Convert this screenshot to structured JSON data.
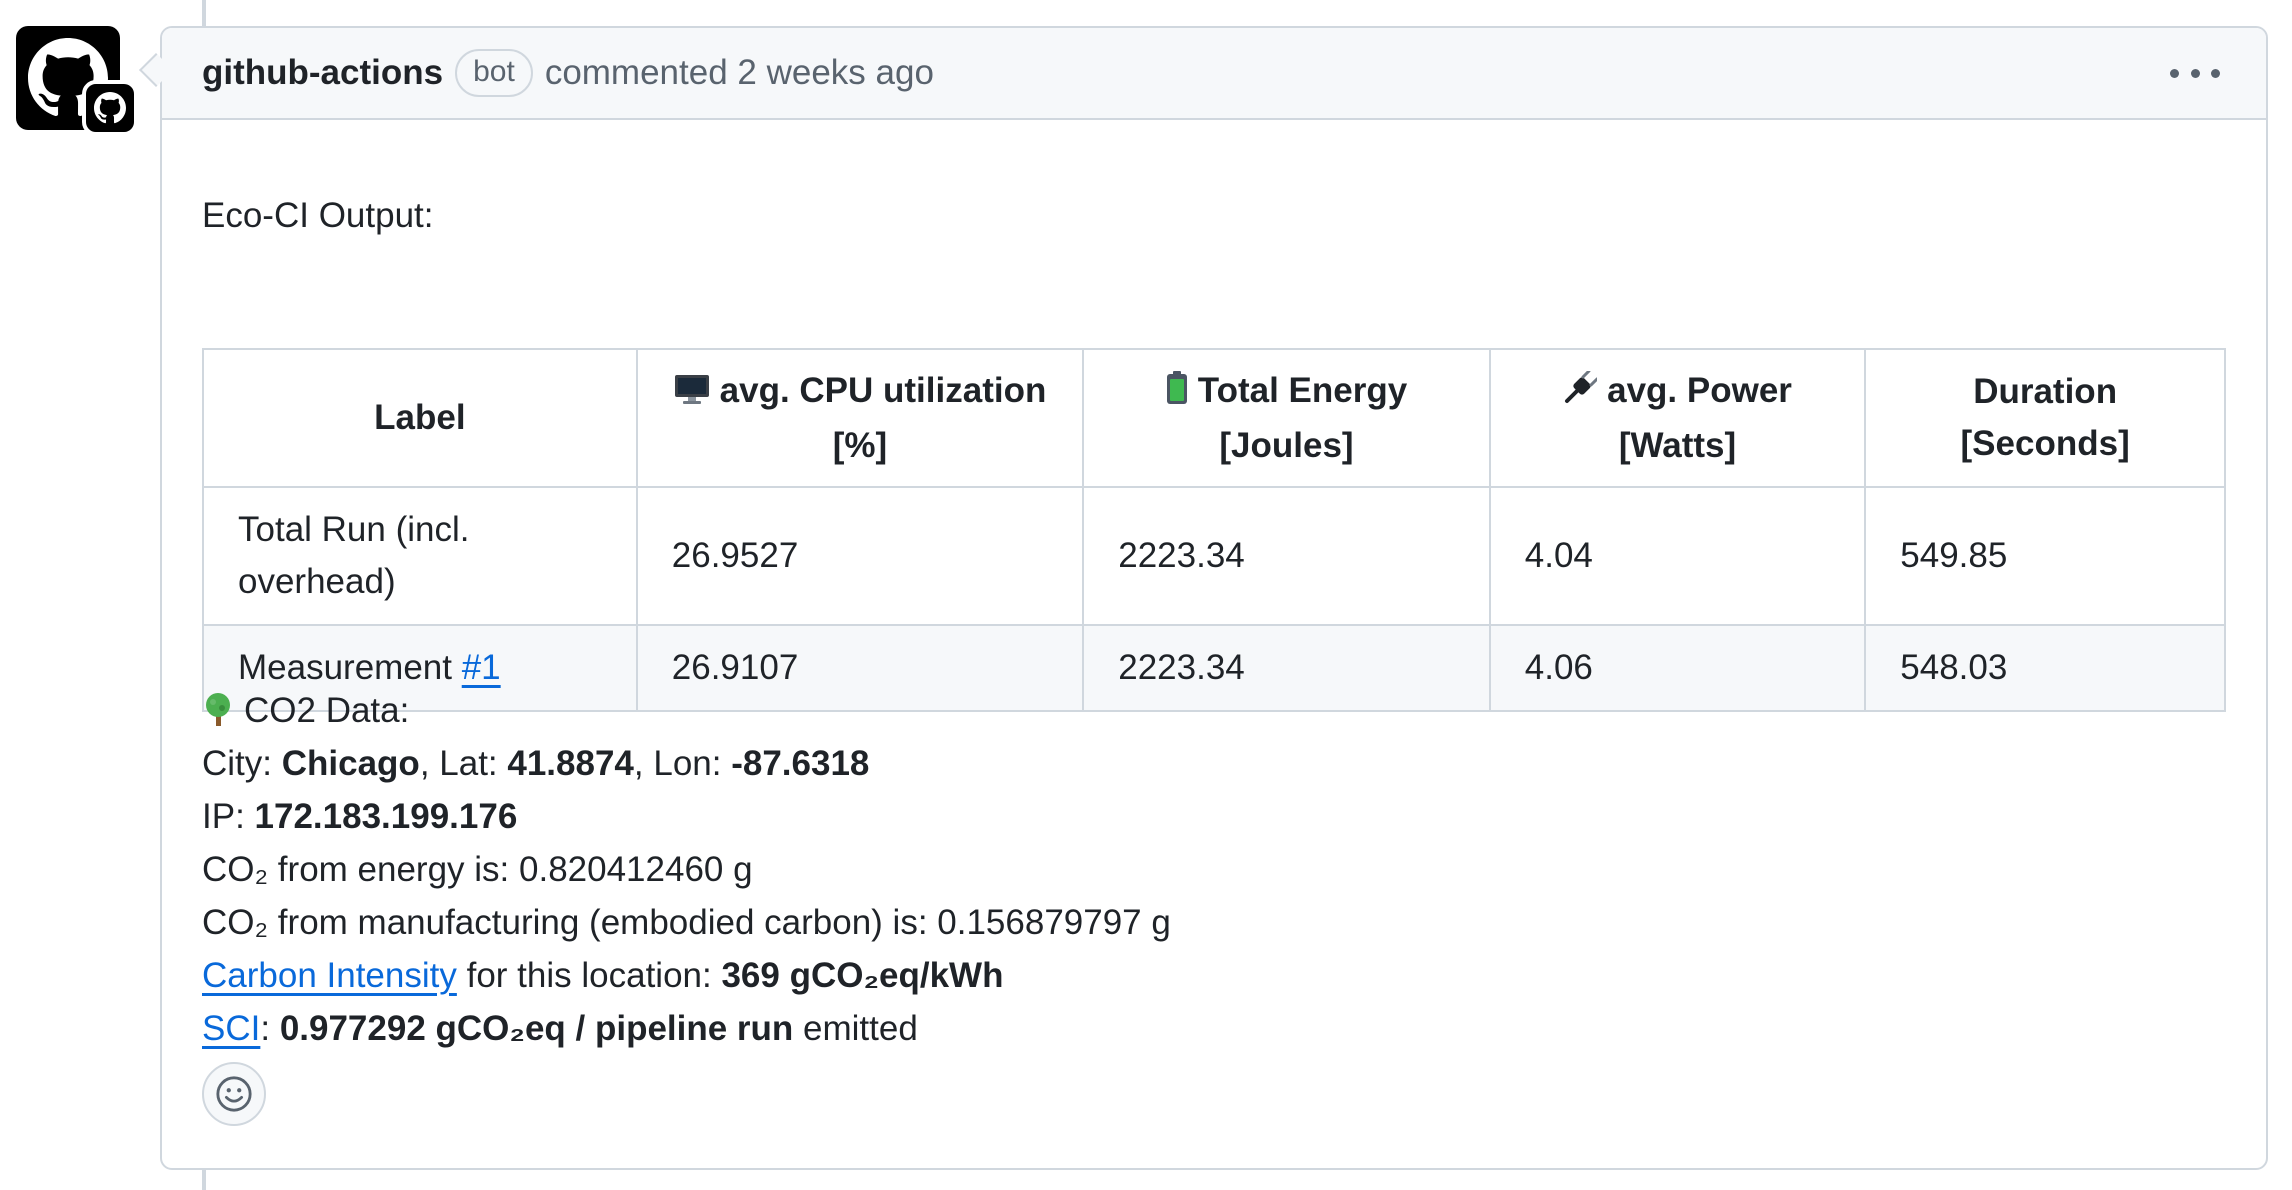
{
  "comment": {
    "author": "github-actions",
    "badge": "bot",
    "meta": "commented 2 weeks ago",
    "menu_icon": "kebab-horizontal-icon",
    "avatar_icon": "github-octocat-icon"
  },
  "body": {
    "intro": "Eco-CI Output:",
    "table": {
      "headers": {
        "label": "Label",
        "cpu_line1": "avg. CPU utilization",
        "cpu_line2": "[%]",
        "energy_line1": "Total Energy",
        "energy_line2": "[Joules]",
        "power_line1": "avg. Power",
        "power_line2": "[Watts]",
        "duration_line1": "Duration",
        "duration_line2": "[Seconds]"
      },
      "header_icons": {
        "cpu": "monitor-icon",
        "energy": "battery-icon",
        "power": "plug-icon"
      },
      "rows": [
        {
          "label": "Total Run (incl. overhead)",
          "cpu": "26.9527",
          "energy": "2223.34",
          "power": "4.04",
          "duration": "549.85"
        },
        {
          "label": "Measurement ",
          "link": "#1",
          "cpu": "26.9107",
          "energy": "2223.34",
          "power": "4.06",
          "duration": "548.03"
        }
      ]
    },
    "co2": {
      "heading": "CO2 Data:",
      "heading_icon": "tree-icon",
      "city_label": "City: ",
      "city": "Chicago",
      "lat_label": ", Lat: ",
      "lat": "41.8874",
      "lon_label": ", Lon: ",
      "lon": "-87.6318",
      "ip_label": "IP: ",
      "ip": "172.183.199.176",
      "energy_line": "CO₂ from energy is: 0.820412460 g",
      "manufacturing_line": "CO₂ from manufacturing (embodied carbon) is: 0.156879797 g",
      "carbon_intensity_link": "Carbon Intensity",
      "carbon_intensity_text": " for this location: ",
      "carbon_intensity_value": "369 gCO₂eq/kWh",
      "sci_link": "SCI",
      "sci_colon": ": ",
      "sci_value": "0.977292 gCO₂eq / pipeline run",
      "sci_suffix": " emitted"
    }
  },
  "reaction_icon": "smiley-icon",
  "colors": {
    "border": "#d0d7de",
    "header_bg": "#f6f8fa",
    "link": "#0969da",
    "muted": "#59636e",
    "text": "#1f2328"
  }
}
